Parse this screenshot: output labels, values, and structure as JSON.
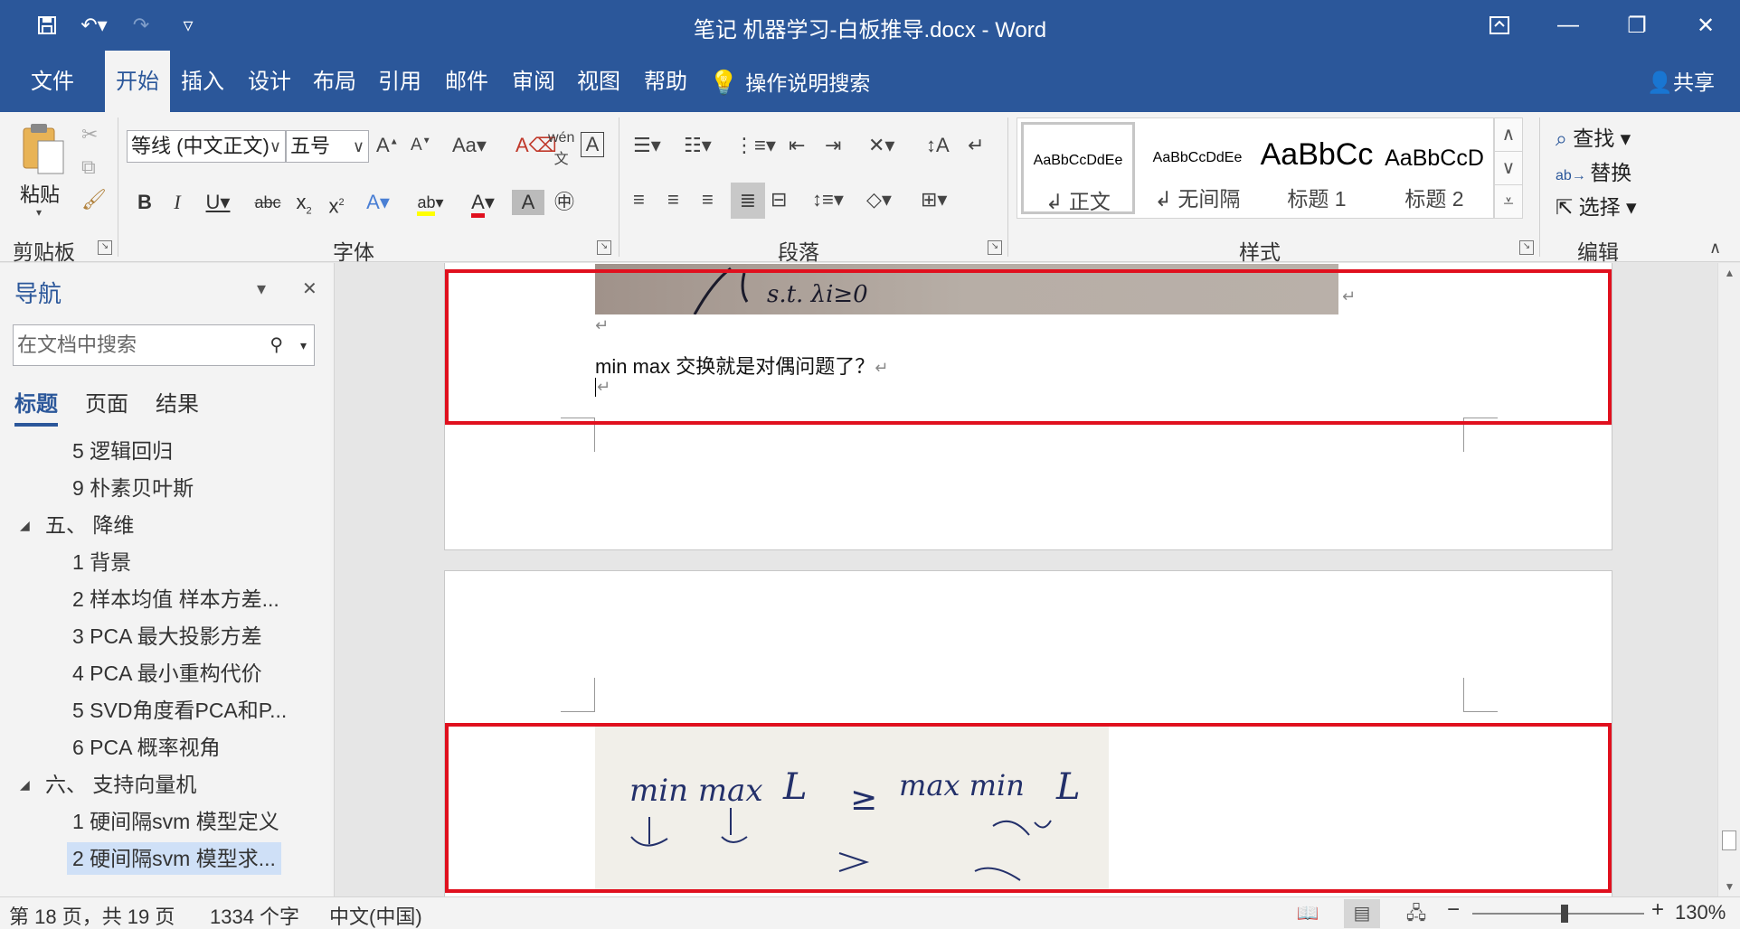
{
  "window": {
    "title": "笔记 机器学习-白板推导.docx  -  Word",
    "qat": {
      "save_icon": "save-icon",
      "undo_icon": "undo-icon",
      "redo_icon": "redo-icon",
      "customize_icon": "chevron-down-icon"
    },
    "controls": {
      "ribbon_display": "ribbon-display-icon",
      "minimize": "minimize-icon",
      "restore": "restore-icon",
      "close": "close-icon"
    }
  },
  "tabs": {
    "file": "文件",
    "home": "开始",
    "insert": "插入",
    "design": "设计",
    "layout": "布局",
    "references": "引用",
    "mailings": "邮件",
    "review": "审阅",
    "view": "视图",
    "help": "帮助",
    "tell_me": "操作说明搜索",
    "share": "共享"
  },
  "ribbon": {
    "clipboard": {
      "paste": "粘贴",
      "label": "剪贴板"
    },
    "font": {
      "font_name": "等线 (中文正文)",
      "font_size": "五号",
      "label": "字体"
    },
    "paragraph": {
      "label": "段落"
    },
    "styles": {
      "label": "样式",
      "items": [
        {
          "sample": "AaBbCcDdEe",
          "name": "↲ 正文"
        },
        {
          "sample": "AaBbCcDdEe",
          "name": "↲ 无间隔"
        },
        {
          "sample": "AaBbCc",
          "name": "标题 1"
        },
        {
          "sample": "AaBbCcD",
          "name": "标题 2"
        }
      ]
    },
    "editing": {
      "find": "查找",
      "replace": "替换",
      "select": "选择",
      "label": "编辑"
    }
  },
  "nav": {
    "title": "导航",
    "search_placeholder": "在文档中搜索",
    "tabs": {
      "headings": "标题",
      "pages": "页面",
      "results": "结果"
    },
    "items": [
      "5 逻辑回归",
      "9 朴素贝叶斯",
      "五、 降维",
      "1 背景",
      "2 样本均值 样本方差...",
      "3 PCA 最大投影方差",
      "4 PCA 最小重构代价",
      "5 SVD角度看PCA和P...",
      "6 PCA 概率视角",
      "六、 支持向量机",
      "1 硬间隔svm 模型定义",
      "2 硬间隔svm 模型求..."
    ]
  },
  "document": {
    "line1": "min max 交换就是对偶问题了？",
    "para_mark": "↵",
    "photo1_text": "s.t. λi≥0",
    "photo2_text": {
      "left": "min max",
      "leq": "≥",
      "right": "max min",
      "L": "L"
    }
  },
  "status": {
    "page": "第 18 页，共 19 页",
    "words": "1334 个字",
    "language": "中文(中国)",
    "zoom": "130%",
    "zoom_out": "−",
    "zoom_in": "+"
  }
}
